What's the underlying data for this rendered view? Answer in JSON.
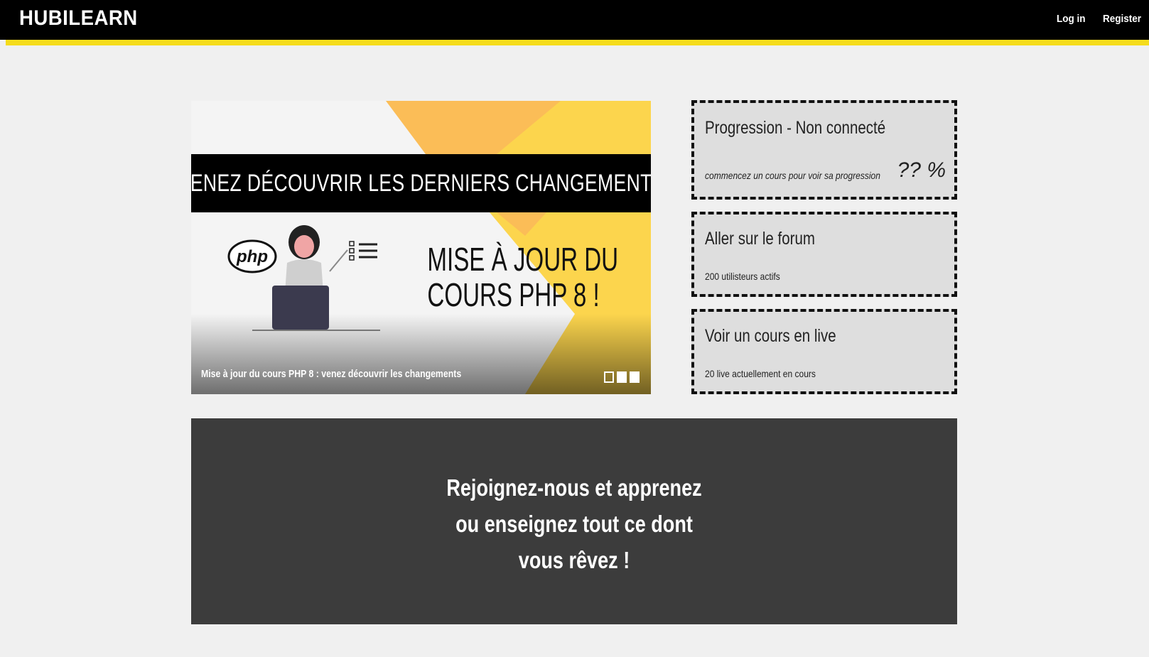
{
  "header": {
    "brand": "HUBILEARN",
    "login_label": "Log in",
    "register_label": "Register",
    "accent_color": "#f5dc1c"
  },
  "carousel": {
    "banner_text": "VENEZ DÉCOUVRIR LES DERNIERS CHANGEMENTS",
    "promo_line1": "MISE À JOUR DU",
    "promo_line2": "COURS PHP 8 !",
    "logo_text": "php",
    "caption": "Mise à jour du cours PHP 8 : venez découvrir les changements",
    "slide_count": 3,
    "active_slide": 1
  },
  "cards": {
    "progress": {
      "title": "Progression - Non connecté",
      "subtitle": "commencez un cours pour voir sa progression",
      "percent": "?? %"
    },
    "forum": {
      "title": "Aller sur le forum",
      "subtitle": "200 utilisteurs actifs"
    },
    "live": {
      "title": "Voir un cours en live",
      "subtitle": "20 live actuellement en cours"
    }
  },
  "join": {
    "line1": "Rejoignez-nous et apprenez",
    "line2": "ou enseignez tout ce dont",
    "line3": "vous rêvez !"
  }
}
